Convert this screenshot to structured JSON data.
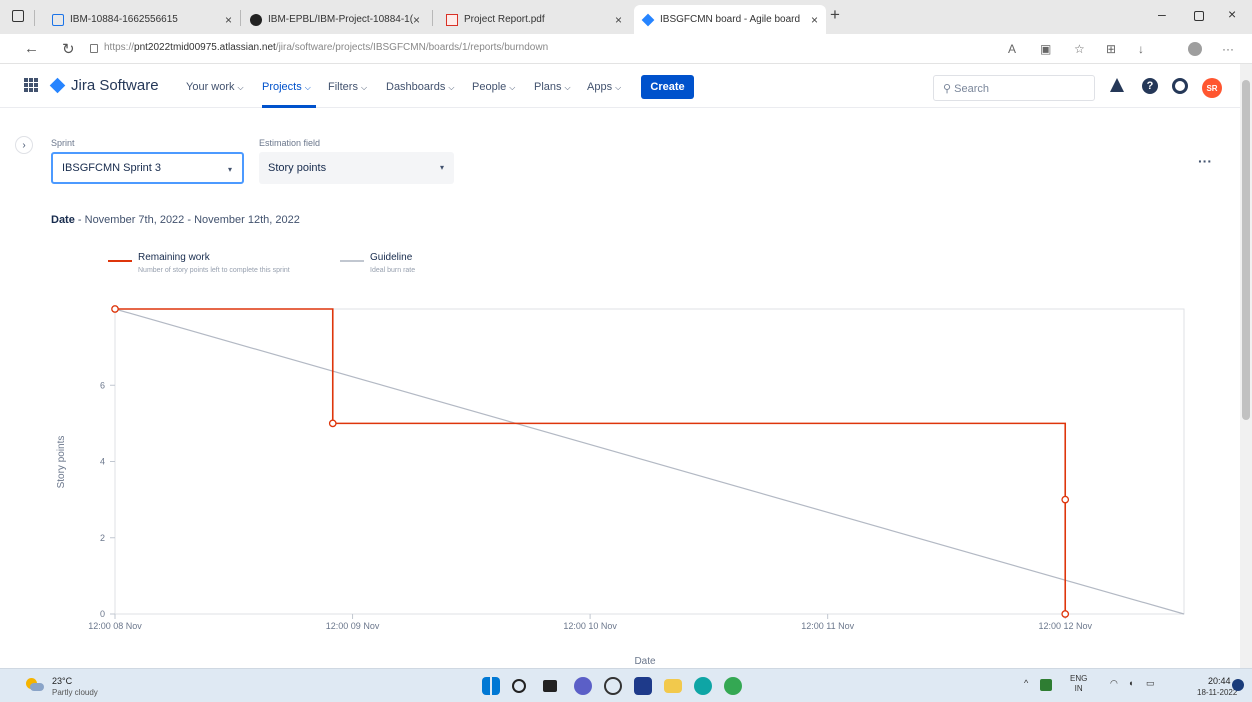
{
  "browser": {
    "tabs": [
      {
        "title": "IBM-10884-1662556615"
      },
      {
        "title": "IBM-EPBL/IBM-Project-10884-1("
      },
      {
        "title": "Project Report.pdf"
      },
      {
        "title": "IBSGFCMN board - Agile board"
      }
    ],
    "url": {
      "prefix": "https://",
      "host": "pnt2022tmid00975.atlassian.net",
      "path": "/jira/software/projects/IBSGFCMN/boards/1/reports/burndown"
    }
  },
  "jira": {
    "product": "Jira Software",
    "nav": [
      "Your work",
      "Projects",
      "Filters",
      "Dashboards",
      "People",
      "Plans",
      "Apps"
    ],
    "create_label": "Create",
    "search_placeholder": "Search",
    "avatar_initials": "SR"
  },
  "filters": {
    "sprint_label": "Sprint",
    "sprint_value": "IBSGFCMN Sprint 3",
    "estimation_label": "Estimation field",
    "estimation_value": "Story points"
  },
  "report": {
    "date_label": "Date",
    "date_range": " - November 7th, 2022 - November 12th, 2022"
  },
  "legend": {
    "remaining_title": "Remaining work",
    "remaining_sub": "Number of story points left to complete this sprint",
    "guideline_title": "Guideline",
    "guideline_sub": "Ideal burn rate"
  },
  "chart_data": {
    "type": "line",
    "xlabel": "Date",
    "ylabel": "Story points",
    "x_ticks": [
      "12:00 08 Nov",
      "12:00 09 Nov",
      "12:00 10 Nov",
      "12:00 11 Nov",
      "12:00 12 Nov"
    ],
    "y_ticks": [
      0,
      2,
      4,
      6
    ],
    "xlim": [
      "2022-11-08 12:00",
      "2022-11-13 00:00"
    ],
    "ylim": [
      0,
      8
    ],
    "series": [
      {
        "name": "Remaining work",
        "color": "#de350b",
        "step": true,
        "points": [
          {
            "x": "2022-11-08 12:00",
            "y": 8
          },
          {
            "x": "2022-11-09 10:00",
            "y": 5
          },
          {
            "x": "2022-11-12 12:00",
            "y": 3
          },
          {
            "x": "2022-11-12 12:00",
            "y": 0
          }
        ]
      },
      {
        "name": "Guideline",
        "color": "#b3b9c4",
        "step": false,
        "points": [
          {
            "x": "2022-11-08 12:00",
            "y": 8
          },
          {
            "x": "2022-11-13 00:00",
            "y": 0
          }
        ]
      }
    ]
  },
  "taskbar": {
    "temperature": "23°C",
    "weather": "Partly cloudy",
    "lang_top": "ENG",
    "lang_bottom": "IN",
    "time": "20:44",
    "date": "18-11-2022"
  }
}
